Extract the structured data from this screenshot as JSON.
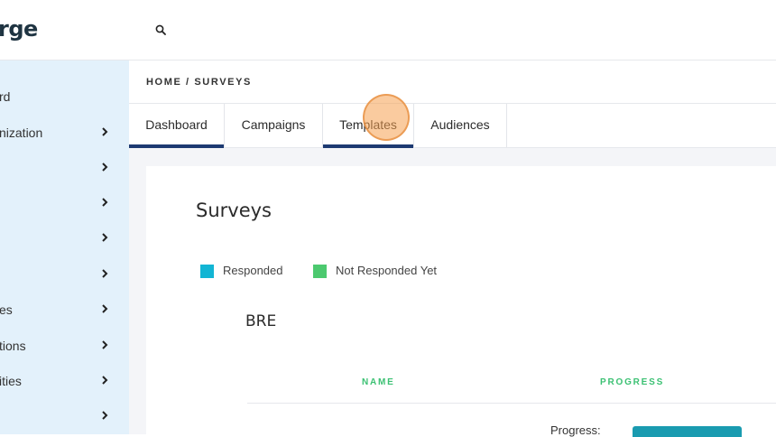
{
  "brand": {
    "logo_text": "rge"
  },
  "header": {
    "search_icon": "search-icon"
  },
  "sidebar": {
    "items": [
      {
        "label": "rd",
        "has_chevron": false
      },
      {
        "label": "nization",
        "has_chevron": true
      },
      {
        "label": "",
        "has_chevron": true
      },
      {
        "label": "",
        "has_chevron": true
      },
      {
        "label": "",
        "has_chevron": true
      },
      {
        "label": "",
        "has_chevron": true
      },
      {
        "label": "es",
        "has_chevron": true
      },
      {
        "label": "tions",
        "has_chevron": true
      },
      {
        "label": "ities",
        "has_chevron": true
      },
      {
        "label": "",
        "has_chevron": true
      }
    ]
  },
  "breadcrumb": "HOME / SURVEYS",
  "tabs": [
    {
      "label": "Dashboard",
      "active": true
    },
    {
      "label": "Campaigns",
      "active": false
    },
    {
      "label": "Templates",
      "active": true
    },
    {
      "label": "Audiences",
      "active": false
    }
  ],
  "main": {
    "title": "Surveys",
    "legend": [
      {
        "label": "Responded",
        "color": "#12b5d4"
      },
      {
        "label": "Not Responded Yet",
        "color": "#4cc96f"
      }
    ],
    "section_title": "BRE",
    "table": {
      "columns": [
        "NAME",
        "PROGRESS"
      ],
      "row_progress_label": "Progress:",
      "progress_color": "#1a9bb0"
    }
  },
  "colors": {
    "accent": "#1d3a72",
    "sidebar_bg": "#e3f1fb",
    "column_header": "#3cc173"
  }
}
